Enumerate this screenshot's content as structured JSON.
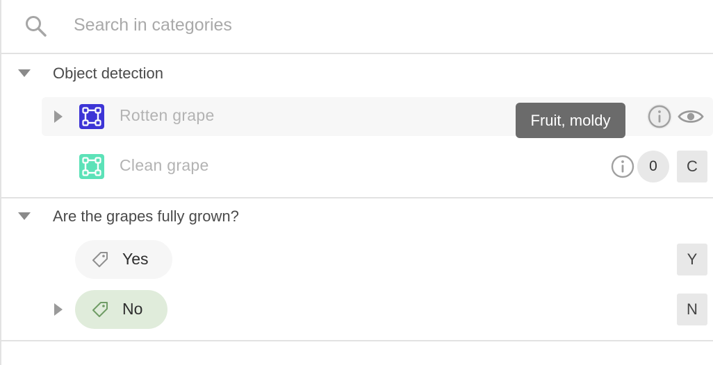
{
  "search": {
    "placeholder": "Search in categories",
    "value": "",
    "icon": "search-icon"
  },
  "sections": [
    {
      "title": "Object detection",
      "expanded": true,
      "items": [
        {
          "label": "Rotten grape",
          "icon": "bounding-box-icon",
          "color": "#3d35d6",
          "expandable": true,
          "hovered": true,
          "tooltip": "Fruit, moldy",
          "actions": [
            "info-icon",
            "eye-icon"
          ]
        },
        {
          "label": "Clean grape",
          "icon": "bounding-box-icon",
          "color": "#5ce2b8",
          "expandable": false,
          "count": "0",
          "shortcut": "C"
        }
      ]
    },
    {
      "title": "Are the grapes fully grown?",
      "expanded": true,
      "options": [
        {
          "label": "Yes",
          "icon": "tag-icon",
          "selected": false,
          "pill_color": "#f6f6f6",
          "shortcut": "Y",
          "expandable": false
        },
        {
          "label": "No",
          "icon": "tag-icon",
          "selected": true,
          "pill_color": "#e0ecdb",
          "tag_color": "#6f9c65",
          "shortcut": "N",
          "expandable": true
        }
      ]
    }
  ]
}
